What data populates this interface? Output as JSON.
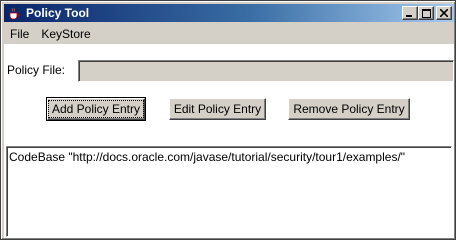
{
  "window": {
    "title": "Policy Tool",
    "app_icon": "java-coffee-cup-icon",
    "title_buttons": [
      "minimize-icon",
      "maximize-icon",
      "close-icon"
    ]
  },
  "menubar": {
    "items": [
      {
        "label": "File"
      },
      {
        "label": "KeyStore"
      }
    ]
  },
  "policy_file": {
    "label": "Policy File:",
    "value": ""
  },
  "buttons": {
    "add": "Add Policy Entry",
    "edit": "Edit Policy Entry",
    "remove": "Remove Policy Entry"
  },
  "entries": [
    {
      "text": "CodeBase \"http://docs.oracle.com/javase/tutorial/security/tour1/examples/\""
    }
  ],
  "colors": {
    "title_bar_start": "#0a246a",
    "title_bar_end": "#a6caf0",
    "window_background": "#d4d0c8"
  }
}
